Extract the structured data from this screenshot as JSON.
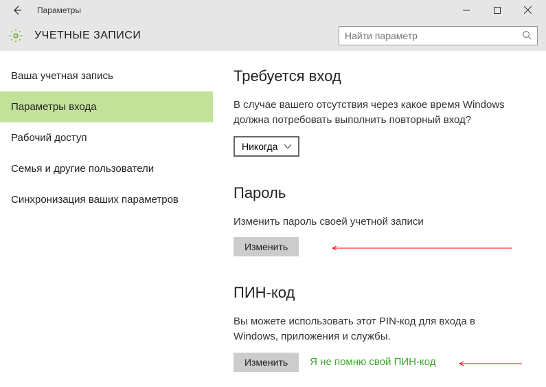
{
  "window": {
    "title": "Параметры"
  },
  "header": {
    "title": "УЧЕТНЫЕ ЗАПИСИ",
    "search_placeholder": "Найти параметр"
  },
  "sidebar": {
    "items": [
      "Ваша учетная запись",
      "Параметры входа",
      "Рабочий доступ",
      "Семья и другие пользователи",
      "Синхронизация ваших параметров"
    ],
    "active_index": 1
  },
  "sections": {
    "signin": {
      "heading": "Требуется вход",
      "desc": "В случае вашего отсутствия через какое время Windows должна потребовать выполнить повторный вход?",
      "combo_value": "Никогда"
    },
    "password": {
      "heading": "Пароль",
      "desc": "Изменить пароль своей учетной записи",
      "button": "Изменить"
    },
    "pin": {
      "heading": "ПИН-код",
      "desc": "Вы можете использовать этот PIN-код для входа в Windows, приложения и службы.",
      "button": "Изменить",
      "forgot_link": "Я не помню свой ПИН-код"
    }
  }
}
